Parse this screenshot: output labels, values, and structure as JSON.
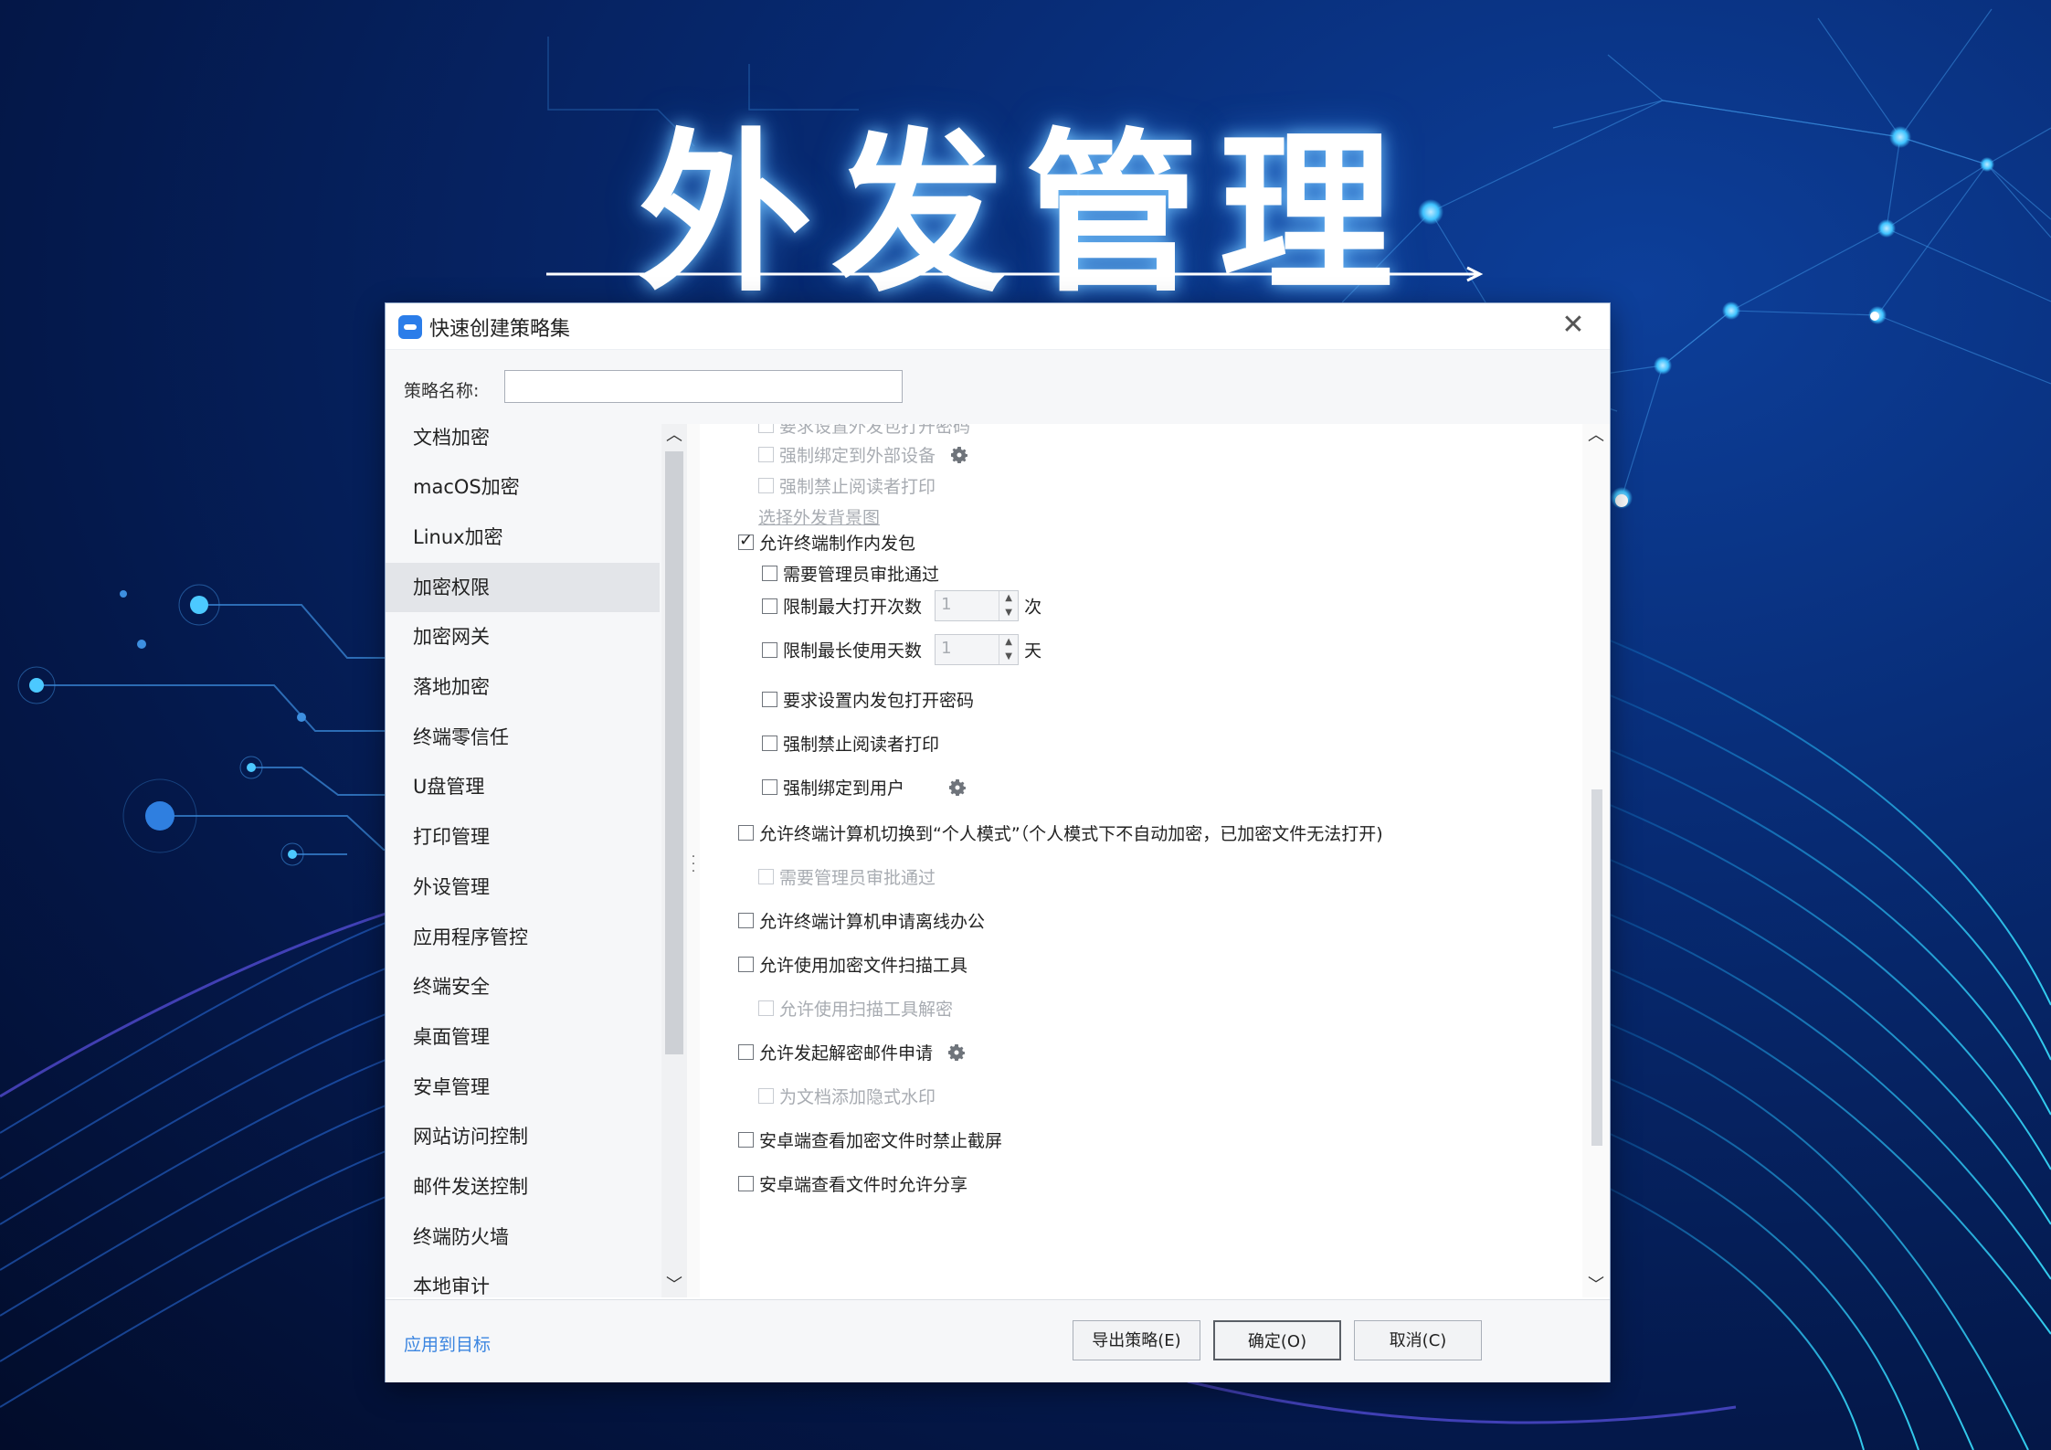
{
  "banner": {
    "title": "外发管理"
  },
  "dialog": {
    "title": "快速创建策略集",
    "close_symbol": "✕",
    "name_label": "策略名称:",
    "name_value": ""
  },
  "sidebar": {
    "items": [
      {
        "label": "文档加密"
      },
      {
        "label": "macOS加密"
      },
      {
        "label": "Linux加密"
      },
      {
        "label": "加密权限",
        "active": true
      },
      {
        "label": "加密网关"
      },
      {
        "label": "落地加密"
      },
      {
        "label": "终端零信任"
      },
      {
        "label": "U盘管理"
      },
      {
        "label": "打印管理"
      },
      {
        "label": "外设管理"
      },
      {
        "label": "应用程序管控"
      },
      {
        "label": "终端安全"
      },
      {
        "label": "桌面管理"
      },
      {
        "label": "安卓管理"
      },
      {
        "label": "网站访问控制"
      },
      {
        "label": "邮件发送控制"
      },
      {
        "label": "终端防火墙"
      },
      {
        "label": "本地审计"
      }
    ]
  },
  "options": {
    "o0": {
      "label": "要求设置外发包打开密码",
      "checked": false,
      "enabled": false
    },
    "o1": {
      "label": "强制绑定到外部设备",
      "checked": false,
      "enabled": false
    },
    "o2": {
      "label": "强制禁止阅读者打印",
      "checked": false,
      "enabled": false
    },
    "bg_link": "选择外发背景图",
    "o3": {
      "label": "允许终端制作内发包",
      "checked": true,
      "enabled": true
    },
    "o4": {
      "label": "需要管理员审批通过",
      "checked": false,
      "enabled": true
    },
    "o5": {
      "label": "限制最大打开次数",
      "checked": false,
      "enabled": true,
      "value": "1",
      "unit": "次"
    },
    "o6": {
      "label": "限制最长使用天数",
      "checked": false,
      "enabled": true,
      "value": "1",
      "unit": "天"
    },
    "o7": {
      "label": "要求设置内发包打开密码",
      "checked": false,
      "enabled": true
    },
    "o8": {
      "label": "强制禁止阅读者打印",
      "checked": false,
      "enabled": true
    },
    "o9": {
      "label": "强制绑定到用户",
      "checked": false,
      "enabled": true
    },
    "o10": {
      "label": "允许终端计算机切换到“个人模式”（个人模式下不自动加密，已加密文件无法打开)",
      "checked": false,
      "enabled": true
    },
    "o11": {
      "label": "需要管理员审批通过",
      "checked": false,
      "enabled": false
    },
    "o12": {
      "label": "允许终端计算机申请离线办公",
      "checked": false,
      "enabled": true
    },
    "o13": {
      "label": "允许使用加密文件扫描工具",
      "checked": false,
      "enabled": true
    },
    "o14": {
      "label": "允许使用扫描工具解密",
      "checked": false,
      "enabled": false
    },
    "o15": {
      "label": "允许发起解密邮件申请",
      "checked": false,
      "enabled": true
    },
    "o16": {
      "label": "为文档添加隐式水印",
      "checked": false,
      "enabled": false
    },
    "o17": {
      "label": "安卓端查看加密文件时禁止截屏",
      "checked": false,
      "enabled": true
    },
    "o18": {
      "label": "安卓端查看文件时允许分享",
      "checked": false,
      "enabled": true
    }
  },
  "footer": {
    "apply_link": "应用到目标",
    "export_label": "导出策略(E)",
    "ok_label": "确定(O)",
    "cancel_label": "取消(C)"
  },
  "colors": {
    "bg_dark": "#020c2a",
    "bg_blue": "#0d3f9a",
    "accent_cyan": "#3fc3ff",
    "link_blue": "#3c86e0"
  }
}
